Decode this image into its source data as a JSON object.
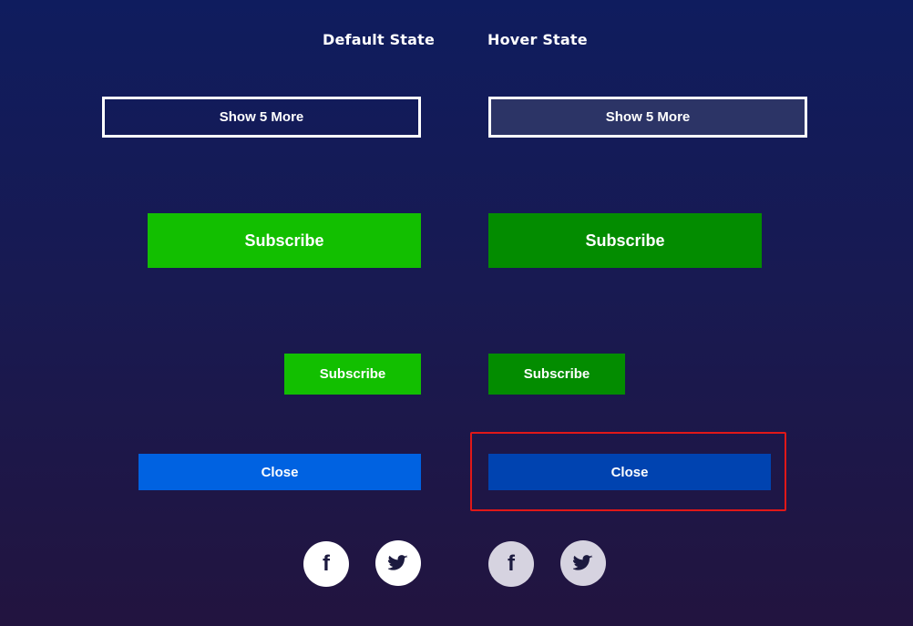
{
  "headings": {
    "default_state": "Default State",
    "hover_state": "Hover State"
  },
  "buttons": {
    "show_more": "Show 5 More",
    "subscribe": "Subscribe",
    "close": "Close"
  },
  "icons": {
    "facebook": "facebook-icon",
    "twitter": "twitter-icon",
    "facebook_glyph": "f"
  },
  "colors": {
    "background_top": "#0f1c5e",
    "background_bottom": "#22143f",
    "green_default": "#12bf00",
    "green_hover": "#038c00",
    "blue_default": "#0062e1",
    "blue_hover": "#0043b0",
    "outline_hover_fill": "#2c3466",
    "highlight": "#e01818"
  }
}
